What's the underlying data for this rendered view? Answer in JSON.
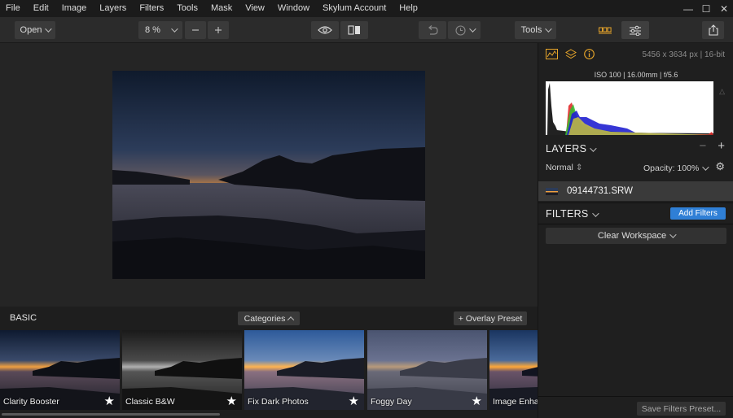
{
  "menu": {
    "items": [
      "File",
      "Edit",
      "Image",
      "Layers",
      "Filters",
      "Tools",
      "Mask",
      "View",
      "Window",
      "Skylum Account",
      "Help"
    ]
  },
  "window_controls": {
    "minimize": "—",
    "maximize": "☐",
    "close": "✕"
  },
  "toolbar": {
    "open_label": "Open",
    "zoom_value": "8 %",
    "tools_label": "Tools"
  },
  "photo": {
    "sky_top": "#0f1a2c",
    "sky_mid": "#2c3c5a",
    "horizon": "#f0a040"
  },
  "presets": {
    "section_title": "BASIC",
    "categories_label": "Categories",
    "overlay_label": "+ Overlay Preset",
    "items": [
      {
        "label": "Clarity Booster",
        "star": "★"
      },
      {
        "label": "Classic B&W",
        "star": "★"
      },
      {
        "label": "Fix Dark Photos",
        "star": "★"
      },
      {
        "label": "Foggy Day",
        "star": "★"
      },
      {
        "label": "Image Enhar",
        "star": ""
      }
    ]
  },
  "panel": {
    "image_dims": "5456 x 3634 px  |  16-bit",
    "exif": "ISO 100  |  16.00mm  |  f/5.6",
    "layers_title": "LAYERS",
    "layers_minus": "−",
    "layers_plus": "+",
    "blend_mode": "Normal",
    "opacity_label": "Opacity: 100%",
    "layer_name": "09144731.SRW",
    "filters_title": "FILTERS",
    "add_filters_label": "Add Filters",
    "clear_workspace_label": "Clear Workspace",
    "save_filters_label": "Save Filters Preset...",
    "accent": "#2f7fd6",
    "icon_accent": "#e8a62a"
  },
  "icons": {
    "histogram": "histogram-icon",
    "layers": "layers-icon",
    "info": "info-icon",
    "eye": "eye-icon",
    "compare": "compare-icon",
    "undo": "undo-icon",
    "history": "history-icon",
    "share": "share-icon",
    "catalog": "catalog-icon",
    "edit": "sliders-icon"
  }
}
